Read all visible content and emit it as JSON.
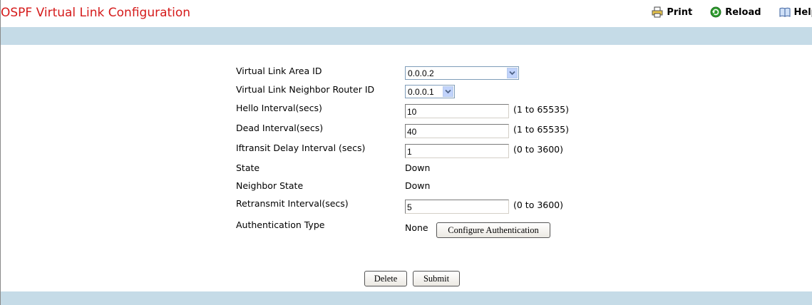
{
  "header": {
    "title": "OSPF Virtual Link Configuration",
    "print_label": "Print",
    "reload_label": "Reload",
    "help_label": "Help"
  },
  "form": {
    "area_id": {
      "label": "Virtual Link Area ID",
      "value": "0.0.0.2"
    },
    "neighbor_router_id": {
      "label": "Virtual Link Neighbor Router ID",
      "value": "0.0.0.1"
    },
    "hello_interval": {
      "label": "Hello Interval(secs)",
      "value": "10",
      "range": "(1 to 65535)"
    },
    "dead_interval": {
      "label": "Dead Interval(secs)",
      "value": "40",
      "range": "(1 to 65535)"
    },
    "iftransit_delay": {
      "label": "Iftransit Delay Interval (secs)",
      "value": "1",
      "range": "(0 to 3600)"
    },
    "state": {
      "label": "State",
      "value": "Down"
    },
    "neighbor_state": {
      "label": "Neighbor State",
      "value": "Down"
    },
    "retransmit_interval": {
      "label": "Retransmit Interval(secs)",
      "value": "5",
      "range": "(0 to 3600)"
    },
    "authentication": {
      "label": "Authentication Type",
      "value": "None",
      "configure_label": "Configure Authentication"
    }
  },
  "actions": {
    "delete_label": "Delete",
    "submit_label": "Submit"
  },
  "colors": {
    "title": "#d51a1a",
    "band": "#c5dbe7"
  },
  "icons": {
    "print": "printer-icon",
    "reload": "reload-icon",
    "help": "help-book-icon"
  }
}
